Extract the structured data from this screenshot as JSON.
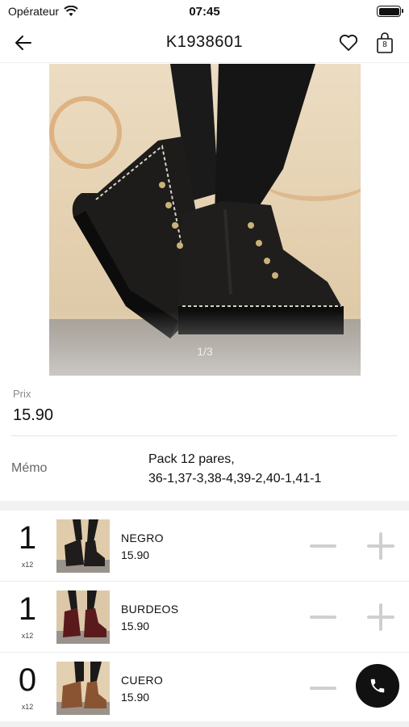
{
  "status_bar": {
    "carrier": "Opérateur",
    "time": "07:45"
  },
  "nav": {
    "title": "K1938601",
    "cart_count": "8"
  },
  "gallery": {
    "counter": "1/3"
  },
  "price": {
    "label": "Prix",
    "value": "15.90"
  },
  "memo": {
    "label": "Mémo",
    "line1": "Pack 12 pares,",
    "line2": "36-1,37-3,38-4,39-2,40-1,41-1"
  },
  "variants": [
    {
      "qty": "1",
      "pack": "x12",
      "name": "NEGRO",
      "price": "15.90",
      "boot_color": "#1f1c1b"
    },
    {
      "qty": "1",
      "pack": "x12",
      "name": "BURDEOS",
      "price": "15.90",
      "boot_color": "#5a1a1c"
    },
    {
      "qty": "0",
      "pack": "x12",
      "name": "CUERO",
      "price": "15.90",
      "boot_color": "#8a5433"
    }
  ],
  "colors": {
    "accent": "#111111",
    "control": "#cfcfcf",
    "section_bg": "#f1f1f1"
  },
  "icons": {
    "back": "arrow-left-icon",
    "favorite": "heart-icon",
    "cart": "bag-icon",
    "minus": "minus-icon",
    "plus": "plus-icon",
    "call": "phone-icon"
  }
}
